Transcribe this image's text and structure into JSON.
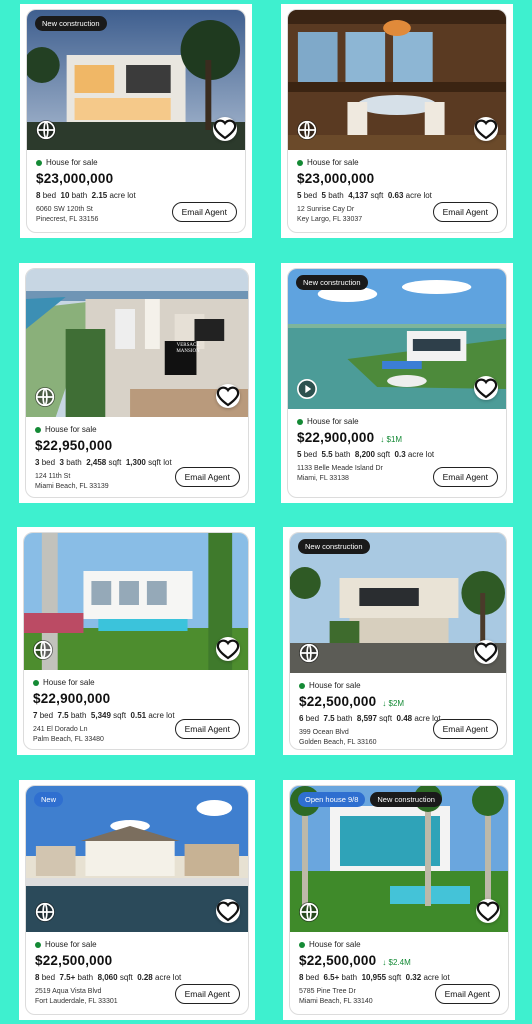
{
  "listings": [
    {
      "tags": [
        {
          "label": "New construction",
          "style": "dark"
        }
      ],
      "media_icon": "globe-icon",
      "status": "House for sale",
      "price": "$23,000,000",
      "price_drop": "",
      "beds": "8",
      "beds_label": "bed",
      "baths": "10",
      "baths_label": "bath",
      "sqft": "",
      "sqft_label": "",
      "lot": "2.15",
      "lot_label": "acre lot",
      "address_line1": "6060 SW 120th St",
      "address_line2": "Pinecrest, FL 33156",
      "email_label": "Email Agent"
    },
    {
      "tags": [],
      "media_icon": "globe-icon",
      "status": "House for sale",
      "price": "$23,000,000",
      "price_drop": "",
      "beds": "5",
      "beds_label": "bed",
      "baths": "5",
      "baths_label": "bath",
      "sqft": "4,137",
      "sqft_label": "sqft",
      "lot": "0.63",
      "lot_label": "acre lot",
      "address_line1": "12 Sunrise Cay Dr",
      "address_line2": "Key Largo, FL 33037",
      "email_label": "Email Agent"
    },
    {
      "tags": [],
      "media_icon": "globe-icon",
      "status": "House for sale",
      "price": "$22,950,000",
      "price_drop": "",
      "beds": "3",
      "beds_label": "bed",
      "baths": "3",
      "baths_label": "bath",
      "sqft": "2,458",
      "sqft_label": "sqft",
      "lot": "1,300",
      "lot_label": "sqft lot",
      "address_line1": "124 11th St",
      "address_line2": "Miami Beach, FL 33139",
      "email_label": "Email Agent",
      "sign_text": "VERSACE MANSION"
    },
    {
      "tags": [
        {
          "label": "New construction",
          "style": "dark"
        }
      ],
      "media_icon": "play-icon",
      "status": "House for sale",
      "price": "$22,900,000",
      "price_drop": "↓ $1M",
      "beds": "5",
      "beds_label": "bed",
      "baths": "5.5",
      "baths_label": "bath",
      "sqft": "8,200",
      "sqft_label": "sqft",
      "lot": "0.3",
      "lot_label": "acre lot",
      "address_line1": "1133 Belle Meade Island Dr",
      "address_line2": "Miami, FL 33138",
      "email_label": "Email Agent"
    },
    {
      "tags": [],
      "media_icon": "globe-icon",
      "status": "House for sale",
      "price": "$22,900,000",
      "price_drop": "",
      "beds": "7",
      "beds_label": "bed",
      "baths": "7.5",
      "baths_label": "bath",
      "sqft": "5,349",
      "sqft_label": "sqft",
      "lot": "0.51",
      "lot_label": "acre lot",
      "address_line1": "241 El Dorado Ln",
      "address_line2": "Palm Beach, FL 33480",
      "email_label": "Email Agent"
    },
    {
      "tags": [
        {
          "label": "New construction",
          "style": "dark"
        }
      ],
      "media_icon": "globe-icon",
      "status": "House for sale",
      "price": "$22,500,000",
      "price_drop": "↓ $2M",
      "beds": "6",
      "beds_label": "bed",
      "baths": "7.5",
      "baths_label": "bath",
      "sqft": "8,597",
      "sqft_label": "sqft",
      "lot": "0.48",
      "lot_label": "acre lot",
      "address_line1": "399 Ocean Blvd",
      "address_line2": "Golden Beach, FL 33160",
      "email_label": "Email Agent"
    },
    {
      "tags": [
        {
          "label": "New",
          "style": "blue"
        }
      ],
      "media_icon": "globe-icon",
      "status": "House for sale",
      "price": "$22,500,000",
      "price_drop": "",
      "beds": "8",
      "beds_label": "bed",
      "baths": "7.5+",
      "baths_label": "bath",
      "sqft": "8,060",
      "sqft_label": "sqft",
      "lot": "0.28",
      "lot_label": "acre lot",
      "address_line1": "2519 Aqua Vista Blvd",
      "address_line2": "Fort Lauderdale, FL 33301",
      "email_label": "Email Agent"
    },
    {
      "tags": [
        {
          "label": "Open house 9/8",
          "style": "blue"
        },
        {
          "label": "New construction",
          "style": "dark"
        }
      ],
      "media_icon": "globe-icon",
      "status": "House for sale",
      "price": "$22,500,000",
      "price_drop": "↓ $2.4M",
      "beds": "8",
      "beds_label": "bed",
      "baths": "6.5+",
      "baths_label": "bath",
      "sqft": "10,955",
      "sqft_label": "sqft",
      "lot": "0.32",
      "lot_label": "acre lot",
      "address_line1": "5785 Pine Tree Dr",
      "address_line2": "Miami Beach, FL 33140",
      "email_label": "Email Agent"
    }
  ],
  "colors": {
    "background": "#3ef0cf",
    "status_dot": "#148a35",
    "price_drop": "#148a35",
    "tag_dark": "#1a1a1a",
    "tag_blue": "#2f6fd0"
  }
}
